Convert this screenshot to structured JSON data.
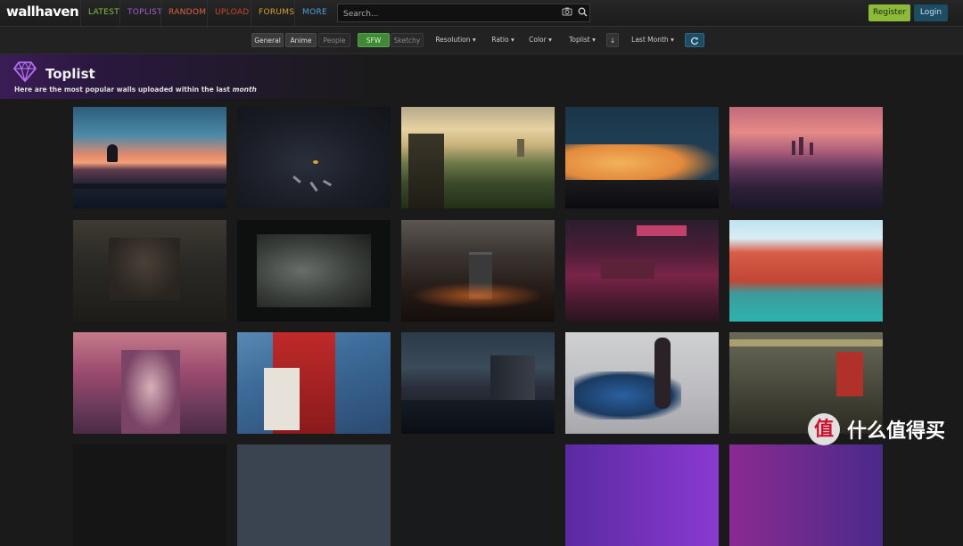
{
  "brand": "wallhaven",
  "nav": [
    {
      "label": "Latest",
      "color": "#89c13d"
    },
    {
      "label": "Toplist",
      "color": "#a45ed6"
    },
    {
      "label": "Random",
      "color": "#d9643f"
    },
    {
      "label": "Upload",
      "color": "#d1442e"
    },
    {
      "label": "Forums",
      "color": "#d1a32a"
    },
    {
      "label": "More",
      "color": "#4aa3dc"
    }
  ],
  "search": {
    "placeholder": "Search...",
    "icons": [
      "camera-icon",
      "search-icon"
    ]
  },
  "auth": {
    "register": "Register",
    "login": "Login"
  },
  "filters": {
    "general": "General",
    "anime": "Anime",
    "people": "People",
    "sfw": "SFW",
    "sketchy": "Sketchy",
    "resolution": "Resolution",
    "ratio": "Ratio",
    "color": "Color",
    "toplist": "Toplist",
    "order_icon": "arrow-down-icon",
    "range": "Last Month",
    "refresh_icon": "refresh-icon"
  },
  "header": {
    "title": "Toplist",
    "subtitle_prefix": "Here are the most popular walls uploaded within the last ",
    "subtitle_period": "month",
    "icon": "diamond-icon"
  },
  "thumbnails": [
    "sunset-city-rooftop",
    "dark-birds",
    "fantasy-warriors-landscape",
    "orange-clouds-night",
    "pink-sunset-city",
    "anime-girl-room",
    "girl-window-room",
    "night-train-city",
    "neon-alley",
    "red-forest-lake",
    "anime-purple-hair-girl",
    "girl-red-dress-flower",
    "bridge-city-night",
    "woman-motorcycle",
    "cyberpunk-subway-group",
    "thumb-16",
    "thumb-17",
    "thumb-18",
    "thumb-19",
    "thumb-20"
  ],
  "watermark": {
    "mark": "值",
    "text": "什么值得买"
  }
}
